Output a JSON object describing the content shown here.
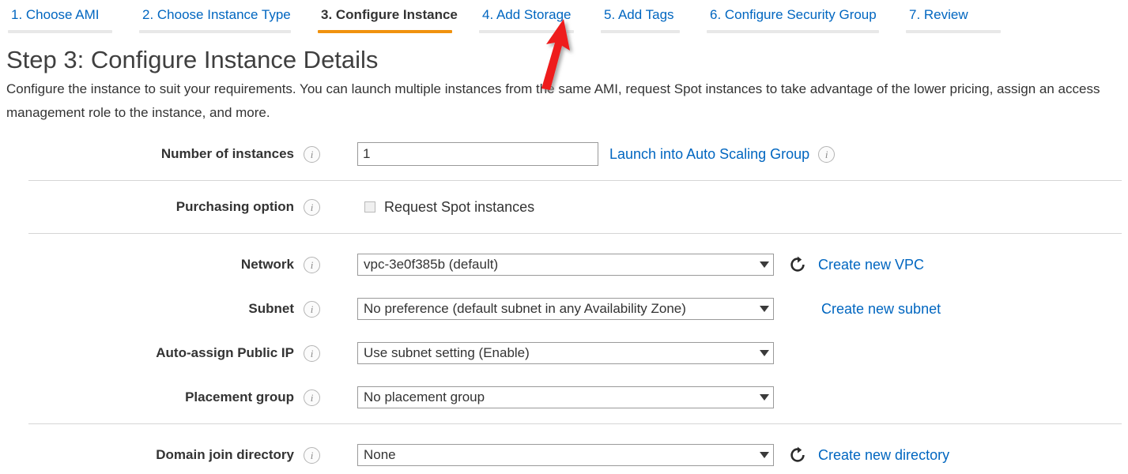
{
  "wizard": {
    "tabs": [
      {
        "label": "1. Choose AMI",
        "active": false
      },
      {
        "label": "2. Choose Instance Type",
        "active": false
      },
      {
        "label": "3. Configure Instance",
        "active": true
      },
      {
        "label": "4. Add Storage",
        "active": false
      },
      {
        "label": "5. Add Tags",
        "active": false
      },
      {
        "label": "6. Configure Security Group",
        "active": false
      },
      {
        "label": "7. Review",
        "active": false
      }
    ],
    "active_underline_color": "#f0920f",
    "inactive_underline_color": "#e8e8e8",
    "link_color": "#0066c0"
  },
  "page": {
    "title": "Step 3: Configure Instance Details",
    "description": "Configure the instance to suit your requirements. You can launch multiple instances from the same AMI, request Spot instances to take advantage of the lower pricing, assign an access management role to the instance, and more."
  },
  "info_icon_glyph": "i",
  "form": {
    "number_of_instances": {
      "label": "Number of instances",
      "value": "1",
      "placeholder": "",
      "link_label": "Launch into Auto Scaling Group"
    },
    "purchasing_option": {
      "label": "Purchasing option",
      "checkbox_label": "Request Spot instances",
      "checked": false
    },
    "network": {
      "label": "Network",
      "value": "vpc-3e0f385b (default)",
      "link_label": "Create new VPC",
      "refresh_icon": "refresh-icon"
    },
    "subnet": {
      "label": "Subnet",
      "value": "No preference (default subnet in any Availability Zone)",
      "link_label": "Create new subnet"
    },
    "auto_assign_public_ip": {
      "label": "Auto-assign Public IP",
      "value": "Use subnet setting (Enable)"
    },
    "placement_group": {
      "label": "Placement group",
      "value": "No placement group"
    },
    "domain_join_directory": {
      "label": "Domain join directory",
      "value": "None",
      "link_label": "Create new directory",
      "refresh_icon": "refresh-icon"
    }
  },
  "annotation": {
    "type": "arrow",
    "color": "#ee1c1c",
    "points_to": "4. Add Storage"
  }
}
